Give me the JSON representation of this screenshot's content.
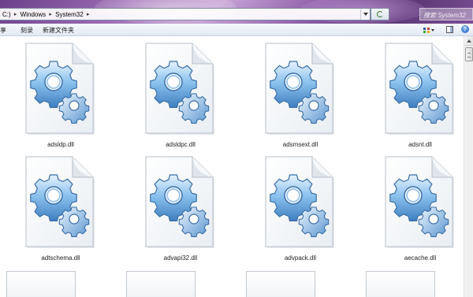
{
  "address": {
    "crumbs": [
      "C:)",
      "Windows",
      "System32"
    ],
    "separator": "▸"
  },
  "search": {
    "placeholder": "搜索 System32"
  },
  "toolbar": {
    "partial_label": "享",
    "burn_label": "刻录",
    "new_folder_label": "新建文件夹",
    "help_label": "?"
  },
  "files": [
    {
      "name": "adsldp.dll",
      "icon": "dll-gear-icon"
    },
    {
      "name": "adsldpc.dll",
      "icon": "dll-gear-icon"
    },
    {
      "name": "adsmsext.dll",
      "icon": "dll-gear-icon"
    },
    {
      "name": "adsnt.dll",
      "icon": "dll-gear-icon"
    },
    {
      "name": "adtschema.dll",
      "icon": "dll-gear-icon"
    },
    {
      "name": "advapi32.dll",
      "icon": "dll-gear-icon"
    },
    {
      "name": "advpack.dll",
      "icon": "dll-gear-icon"
    },
    {
      "name": "aecache.dll",
      "icon": "dll-gear-icon"
    }
  ],
  "colors": {
    "glass_purple": "#8f5fa8",
    "toolbar_bg": "#e3eaf4",
    "gear_blue": "#7fb6e6"
  }
}
